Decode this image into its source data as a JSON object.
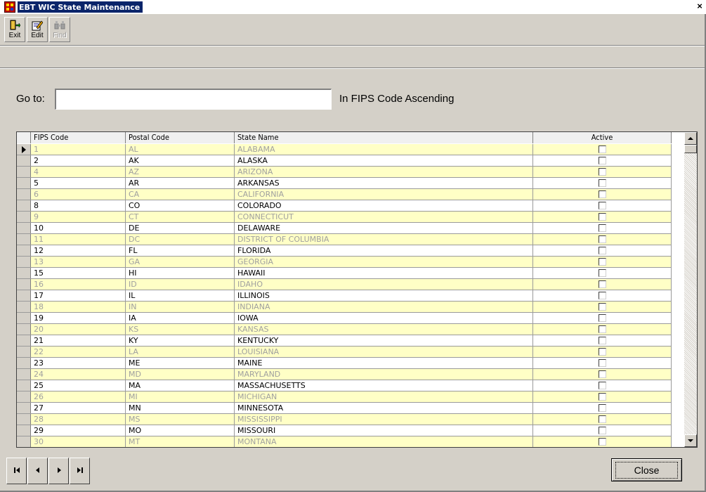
{
  "window": {
    "title": "EBT WIC State Maintenance",
    "close_glyph": "×"
  },
  "toolbar": {
    "buttons": [
      {
        "label": "Exit",
        "icon": "exit-door-icon",
        "enabled": true
      },
      {
        "label": "Edit",
        "icon": "edit-pencil-icon",
        "enabled": true
      },
      {
        "label": "Find",
        "icon": "binoculars-icon",
        "enabled": false
      }
    ]
  },
  "goto": {
    "label": "Go to:",
    "value": "",
    "order_text": "In FIPS Code Ascending"
  },
  "grid": {
    "columns": [
      "FIPS Code",
      "Postal Code",
      "State Name",
      "Active"
    ],
    "rows": [
      {
        "fips": "1",
        "postal": "AL",
        "state": "ALABAMA",
        "active": false
      },
      {
        "fips": "2",
        "postal": "AK",
        "state": "ALASKA",
        "active": false
      },
      {
        "fips": "4",
        "postal": "AZ",
        "state": "ARIZONA",
        "active": false
      },
      {
        "fips": "5",
        "postal": "AR",
        "state": "ARKANSAS",
        "active": false
      },
      {
        "fips": "6",
        "postal": "CA",
        "state": "CALIFORNIA",
        "active": false
      },
      {
        "fips": "8",
        "postal": "CO",
        "state": "COLORADO",
        "active": false
      },
      {
        "fips": "9",
        "postal": "CT",
        "state": "CONNECTICUT",
        "active": false
      },
      {
        "fips": "10",
        "postal": "DE",
        "state": "DELAWARE",
        "active": false
      },
      {
        "fips": "11",
        "postal": "DC",
        "state": "DISTRICT OF COLUMBIA",
        "active": false
      },
      {
        "fips": "12",
        "postal": "FL",
        "state": "FLORIDA",
        "active": false
      },
      {
        "fips": "13",
        "postal": "GA",
        "state": "GEORGIA",
        "active": false
      },
      {
        "fips": "15",
        "postal": "HI",
        "state": "HAWAII",
        "active": false
      },
      {
        "fips": "16",
        "postal": "ID",
        "state": "IDAHO",
        "active": false
      },
      {
        "fips": "17",
        "postal": "IL",
        "state": "ILLINOIS",
        "active": false
      },
      {
        "fips": "18",
        "postal": "IN",
        "state": "INDIANA",
        "active": false
      },
      {
        "fips": "19",
        "postal": "IA",
        "state": "IOWA",
        "active": false
      },
      {
        "fips": "20",
        "postal": "KS",
        "state": "KANSAS",
        "active": false
      },
      {
        "fips": "21",
        "postal": "KY",
        "state": "KENTUCKY",
        "active": false
      },
      {
        "fips": "22",
        "postal": "LA",
        "state": "LOUISIANA",
        "active": false
      },
      {
        "fips": "23",
        "postal": "ME",
        "state": "MAINE",
        "active": false
      },
      {
        "fips": "24",
        "postal": "MD",
        "state": "MARYLAND",
        "active": false
      },
      {
        "fips": "25",
        "postal": "MA",
        "state": "MASSACHUSETTS",
        "active": false
      },
      {
        "fips": "26",
        "postal": "MI",
        "state": "MICHIGAN",
        "active": false
      },
      {
        "fips": "27",
        "postal": "MN",
        "state": "MINNESOTA",
        "active": false
      },
      {
        "fips": "28",
        "postal": "MS",
        "state": "MISSISSIPPI",
        "active": false
      },
      {
        "fips": "29",
        "postal": "MO",
        "state": "MISSOURI",
        "active": false
      },
      {
        "fips": "30",
        "postal": "MT",
        "state": "MONTANA",
        "active": false
      }
    ]
  },
  "navigation": {
    "buttons": [
      {
        "name": "first-record",
        "icon": "first-record-icon"
      },
      {
        "name": "previous-record",
        "icon": "previous-record-icon"
      },
      {
        "name": "next-record",
        "icon": "next-record-icon"
      },
      {
        "name": "last-record",
        "icon": "last-record-icon"
      }
    ]
  },
  "footer": {
    "close_label": "Close"
  }
}
